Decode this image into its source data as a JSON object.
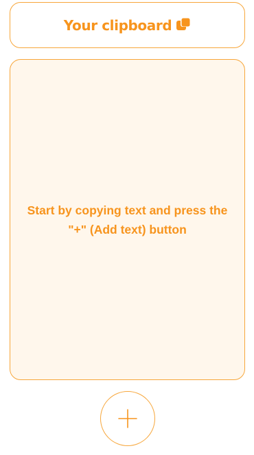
{
  "header": {
    "title": "Your clipboard",
    "icon": "copy-icon"
  },
  "clipboard": {
    "empty_message": "Start by copying text and press the \"+\" (Add text) button"
  },
  "add_button": {
    "icon": "plus-icon"
  },
  "colors": {
    "accent": "#f7941d",
    "border": "#f7a63a",
    "panel_background": "#fff7ec",
    "background": "#ffffff"
  }
}
